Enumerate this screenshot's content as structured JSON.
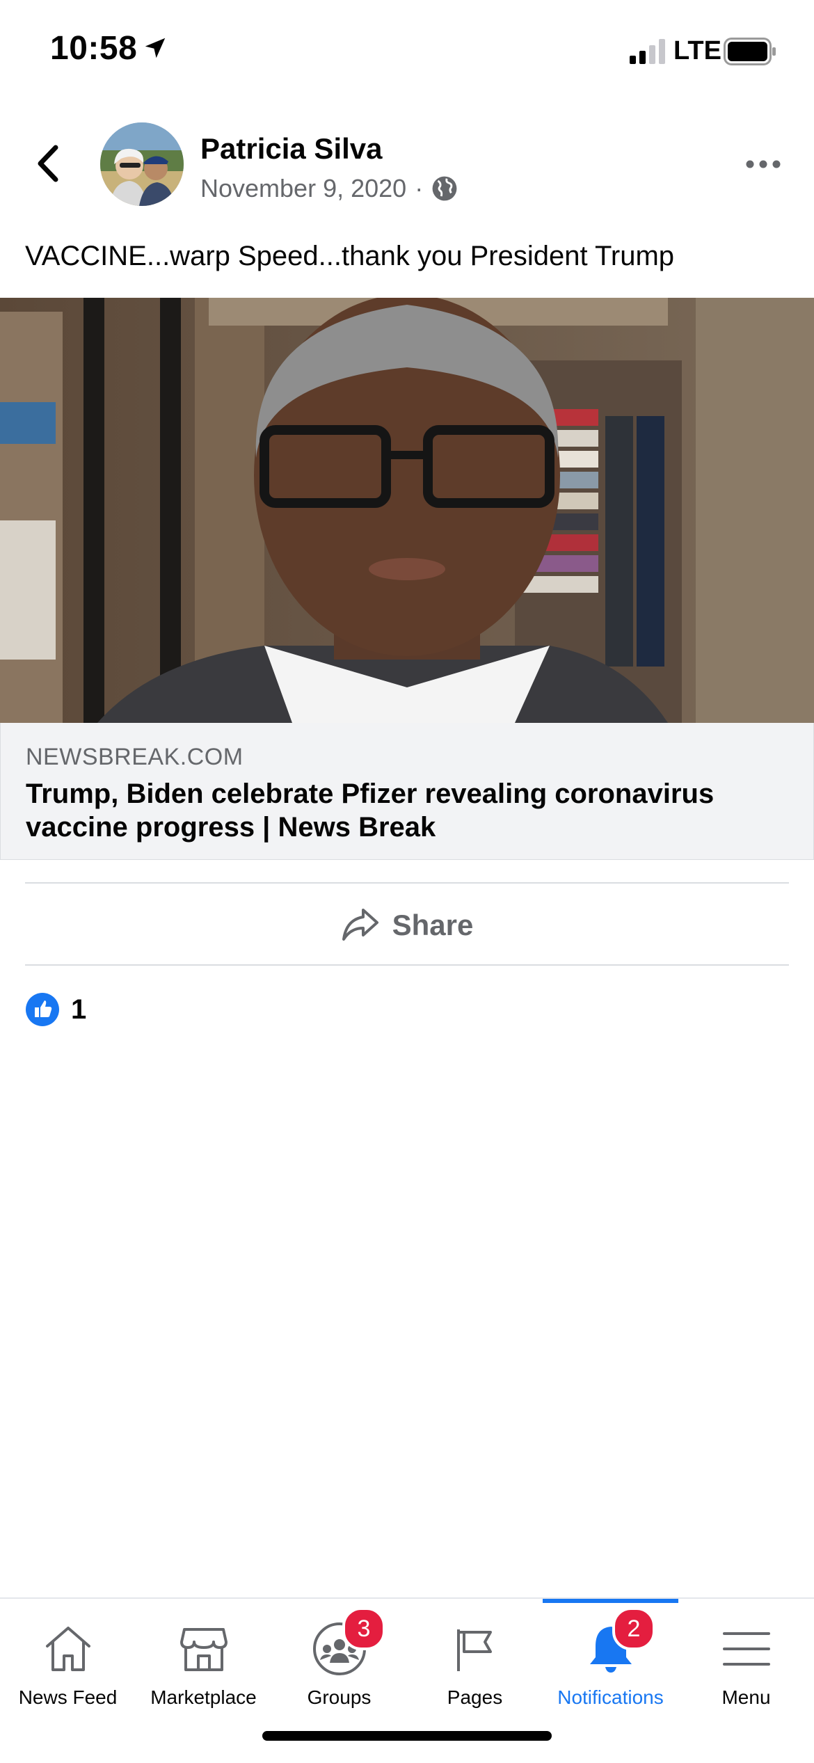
{
  "status_bar": {
    "time": "10:58",
    "network": "LTE",
    "icons": [
      "location-arrow-icon",
      "signal-bars-icon",
      "battery-icon"
    ]
  },
  "post": {
    "author": "Patricia Silva",
    "date": "November 9, 2020",
    "separator": "·",
    "privacy_icon": "globe-icon",
    "text": "VACCINE...warp Speed...thank you President Trump",
    "link": {
      "domain": "NEWSBREAK.COM",
      "title": "Trump, Biden celebrate Pfizer revealing coronavirus vaccine progress | News Break"
    },
    "share_label": "Share",
    "reaction_count": "1"
  },
  "tab_bar": {
    "tabs": [
      {
        "label": "News Feed",
        "icon": "home-icon",
        "badge": ""
      },
      {
        "label": "Marketplace",
        "icon": "shop-icon",
        "badge": ""
      },
      {
        "label": "Groups",
        "icon": "groups-icon",
        "badge": "3"
      },
      {
        "label": "Pages",
        "icon": "flag-icon",
        "badge": ""
      },
      {
        "label": "Notifications",
        "icon": "bell-icon",
        "badge": "2",
        "active": true
      },
      {
        "label": "Menu",
        "icon": "hamburger-icon",
        "badge": ""
      }
    ]
  },
  "colors": {
    "accent": "#1877f2",
    "badge": "#e41e3f",
    "secondary_text": "#65676b"
  }
}
